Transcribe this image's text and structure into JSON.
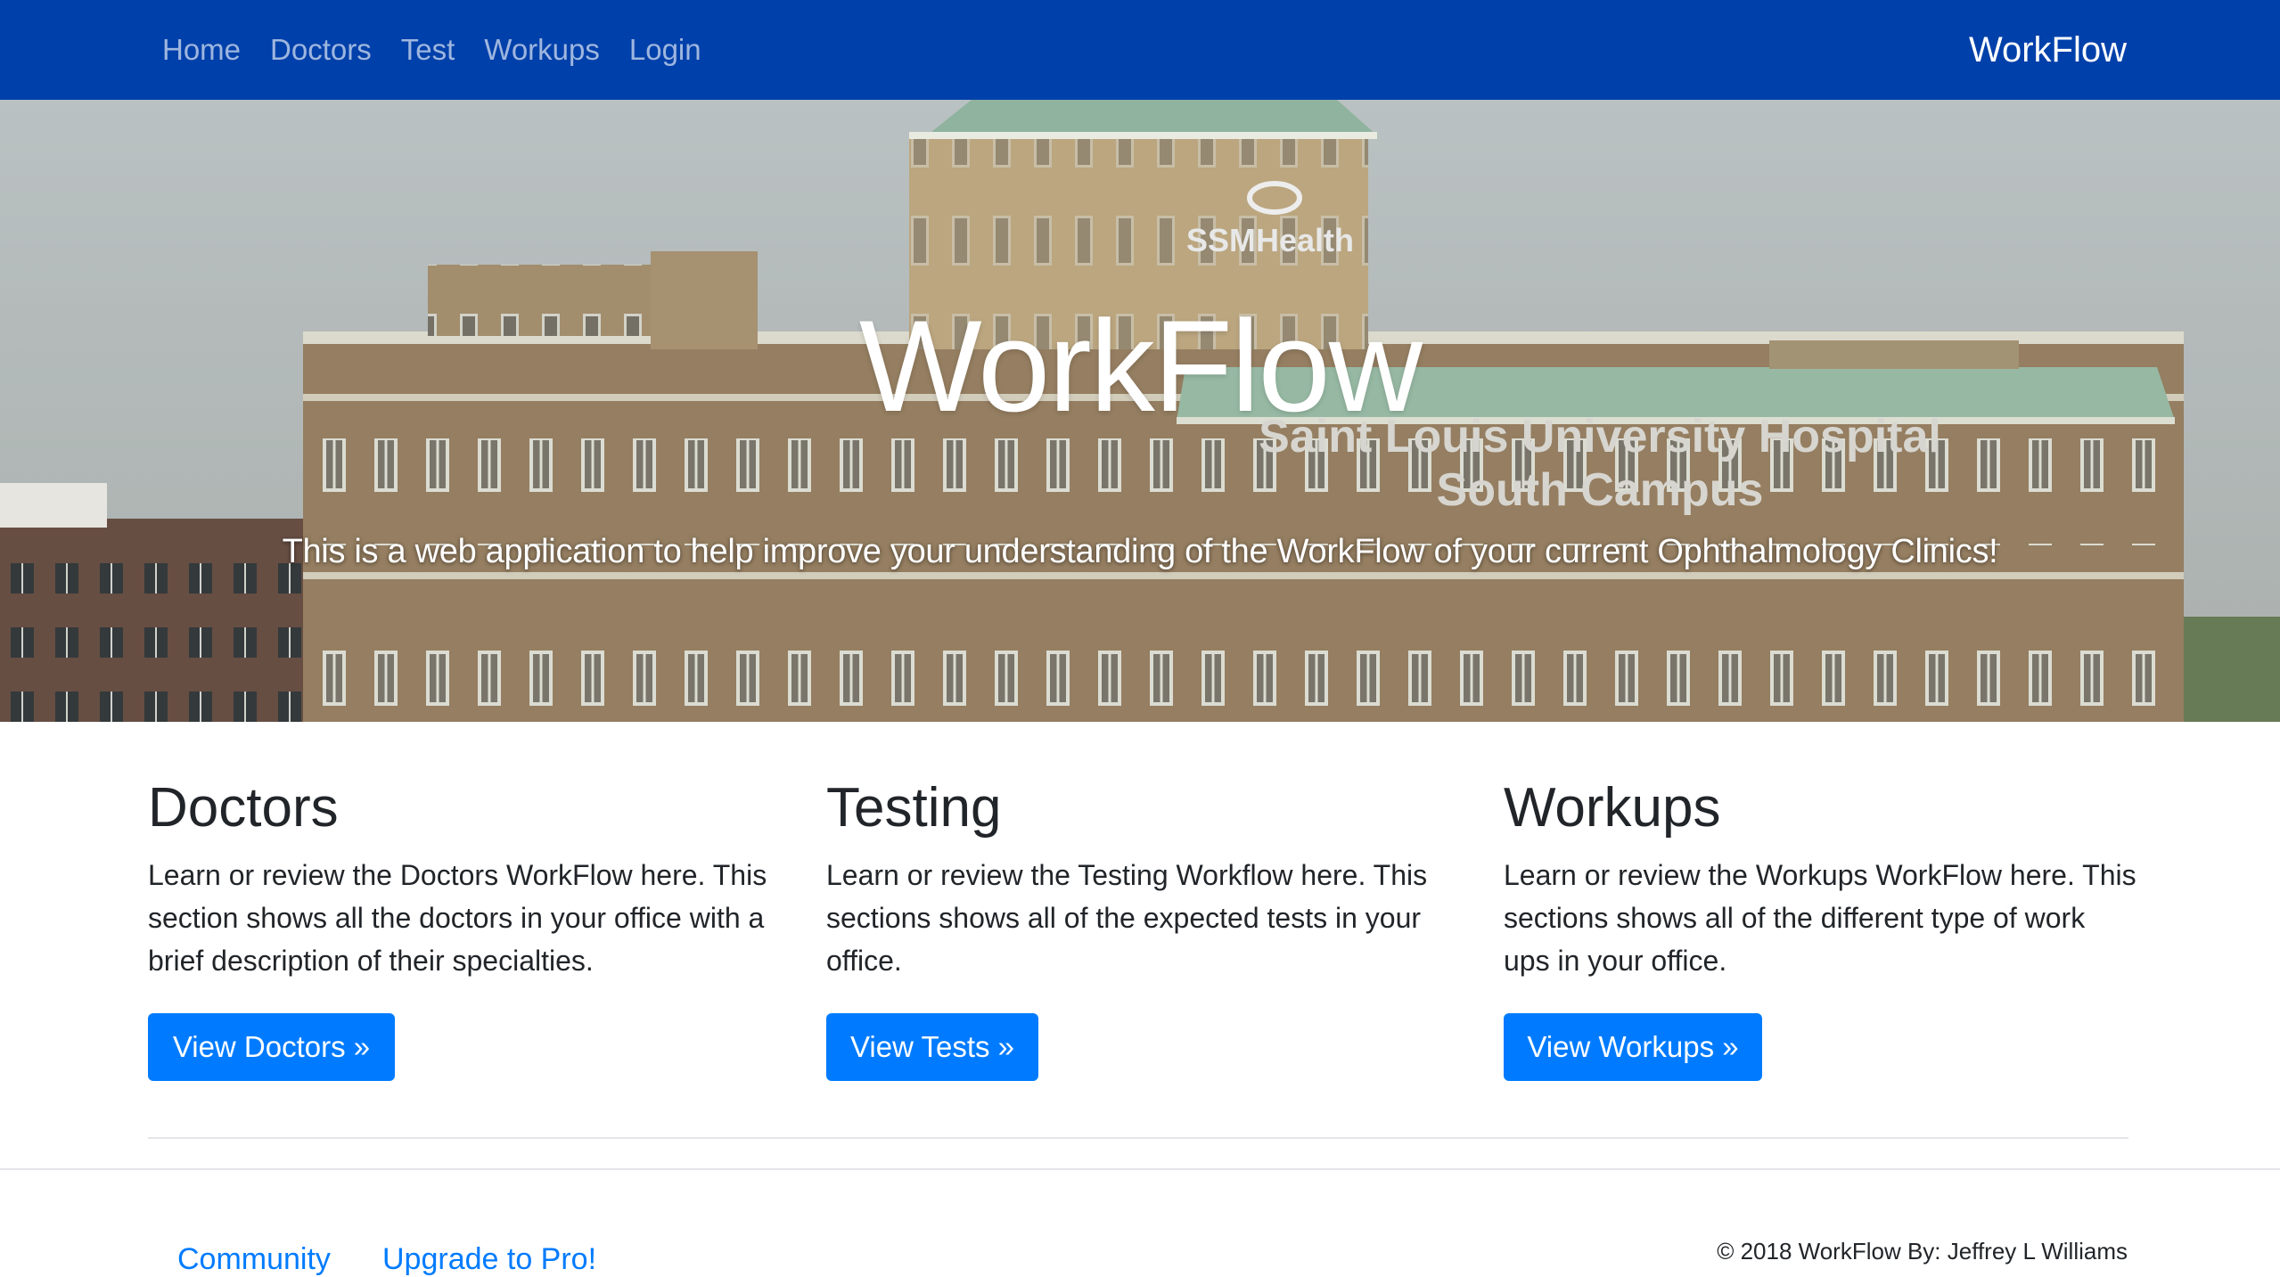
{
  "nav": {
    "links": [
      "Home",
      "Doctors",
      "Test",
      "Workups",
      "Login"
    ],
    "brand": "WorkFlow"
  },
  "hero": {
    "title": "WorkFlow",
    "lead": "This is a web application to help improve your understanding of the WorkFlow of your current Ophthalmology Clinics!",
    "photo_text": {
      "logo": "SSMHealth",
      "line1": "Saint Louis University Hospital",
      "line2": "South Campus"
    }
  },
  "columns": [
    {
      "heading": "Doctors",
      "text": "Learn or review the Doctors WorkFlow here. This section shows all the doctors in your office with a brief description of their specialties.",
      "button": "View Doctors »"
    },
    {
      "heading": "Testing",
      "text": "Learn or review the Testing Workflow here. This sections shows all of the expected tests in your office.",
      "button": "View Tests »"
    },
    {
      "heading": "Workups",
      "text": "Learn or review the Workups WorkFlow here. This sections shows all of the different type of work ups in your office.",
      "button": "View Workups »"
    }
  ],
  "footer": {
    "links": [
      "Community",
      "Upgrade to Pro!"
    ],
    "copyright": "© 2018 WorkFlow By: Jeffrey L Williams"
  },
  "colors": {
    "navbar": "#0040aa",
    "button": "#007bff",
    "link": "#007bff"
  }
}
